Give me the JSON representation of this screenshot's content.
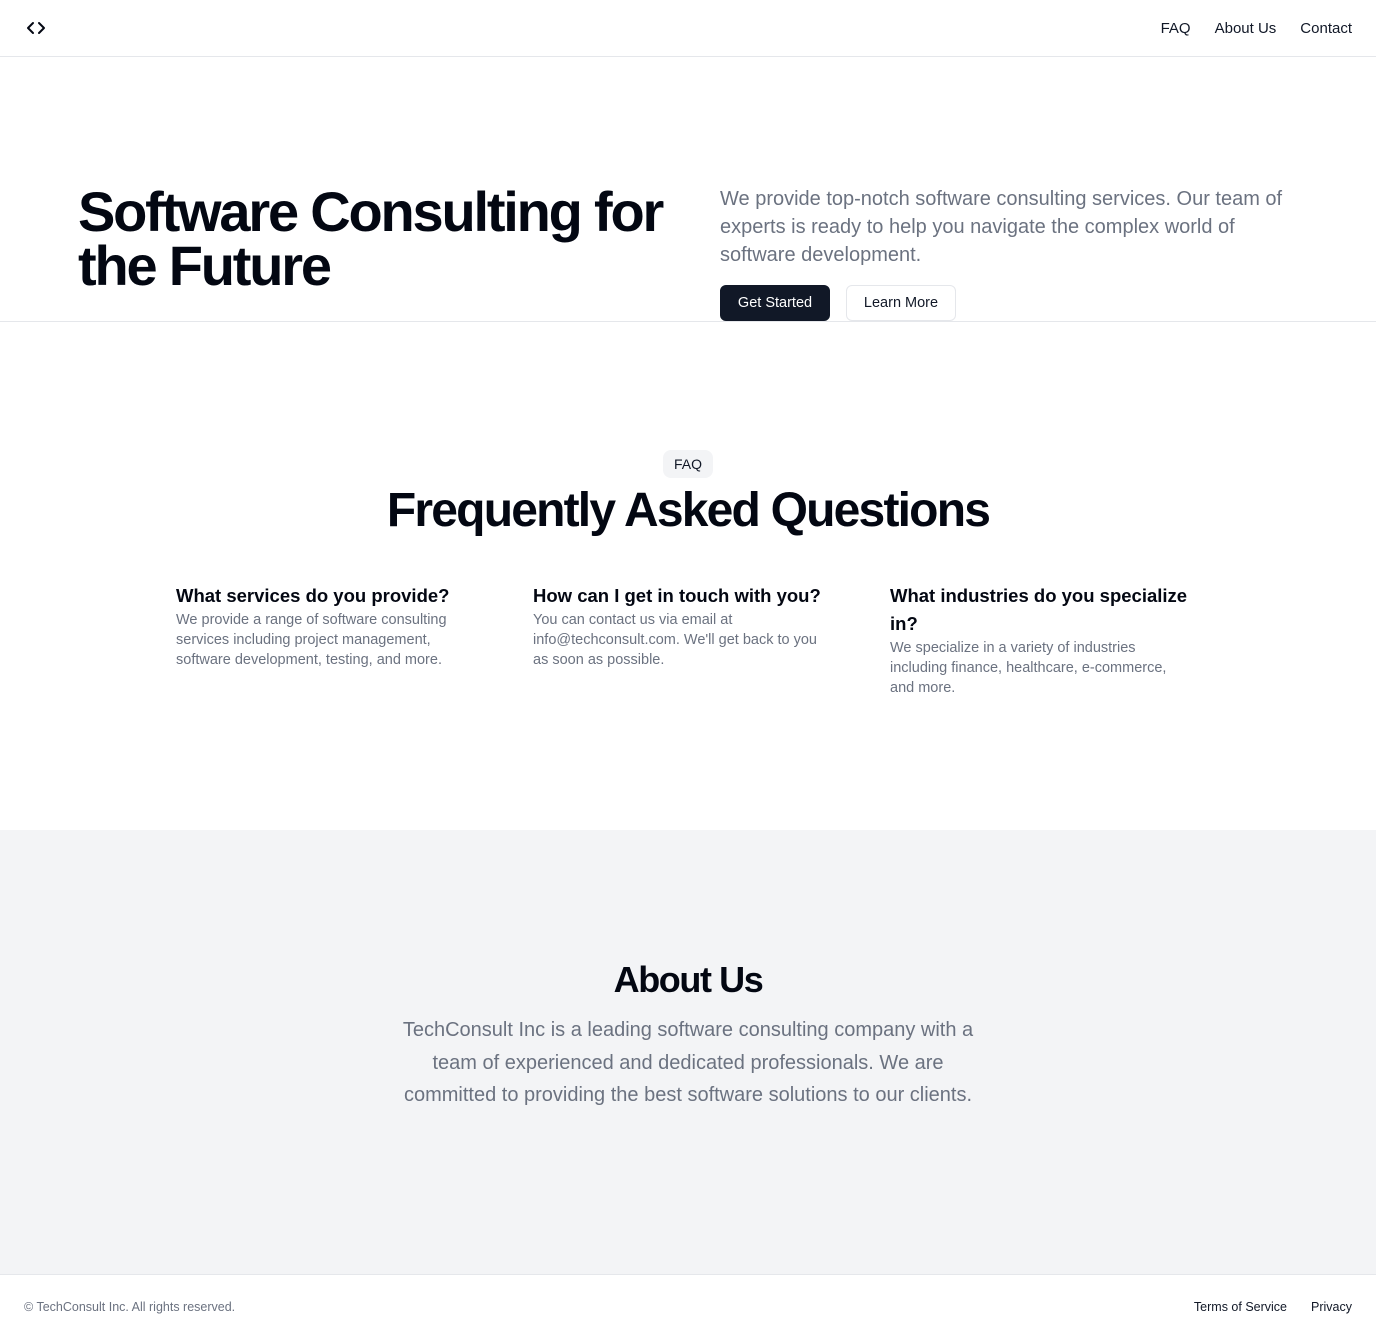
{
  "header": {
    "logo_icon": "code-brackets-icon",
    "nav": [
      {
        "label": "FAQ"
      },
      {
        "label": "About Us"
      },
      {
        "label": "Contact"
      }
    ]
  },
  "hero": {
    "title": "Software Consulting for the Future",
    "description": "We provide top-notch software consulting services. Our team of experts is ready to help you navigate the complex world of software development.",
    "primary_button": "Get Started",
    "secondary_button": "Learn More"
  },
  "faq": {
    "badge": "FAQ",
    "title": "Frequently Asked Questions",
    "items": [
      {
        "question": "What services do you provide?",
        "answer": "We provide a range of software consulting services including project management, software development, testing, and more."
      },
      {
        "question": "How can I get in touch with you?",
        "answer": "You can contact us via email at info@techconsult.com. We'll get back to you as soon as possible."
      },
      {
        "question": "What industries do you specialize in?",
        "answer": "We specialize in a variety of industries including finance, healthcare, e-commerce, and more."
      }
    ]
  },
  "about": {
    "title": "About Us",
    "text": "TechConsult Inc is a leading software consulting company with a team of experienced and dedicated professionals. We are committed to providing the best software solutions to our clients."
  },
  "footer": {
    "copyright": "© TechConsult Inc. All rights reserved.",
    "links": [
      {
        "label": "Terms of Service"
      },
      {
        "label": "Privacy"
      }
    ]
  },
  "colors": {
    "primary": "#111827",
    "muted_text": "#6b7280",
    "section_bg": "#f3f4f6",
    "border": "#e5e7eb"
  }
}
